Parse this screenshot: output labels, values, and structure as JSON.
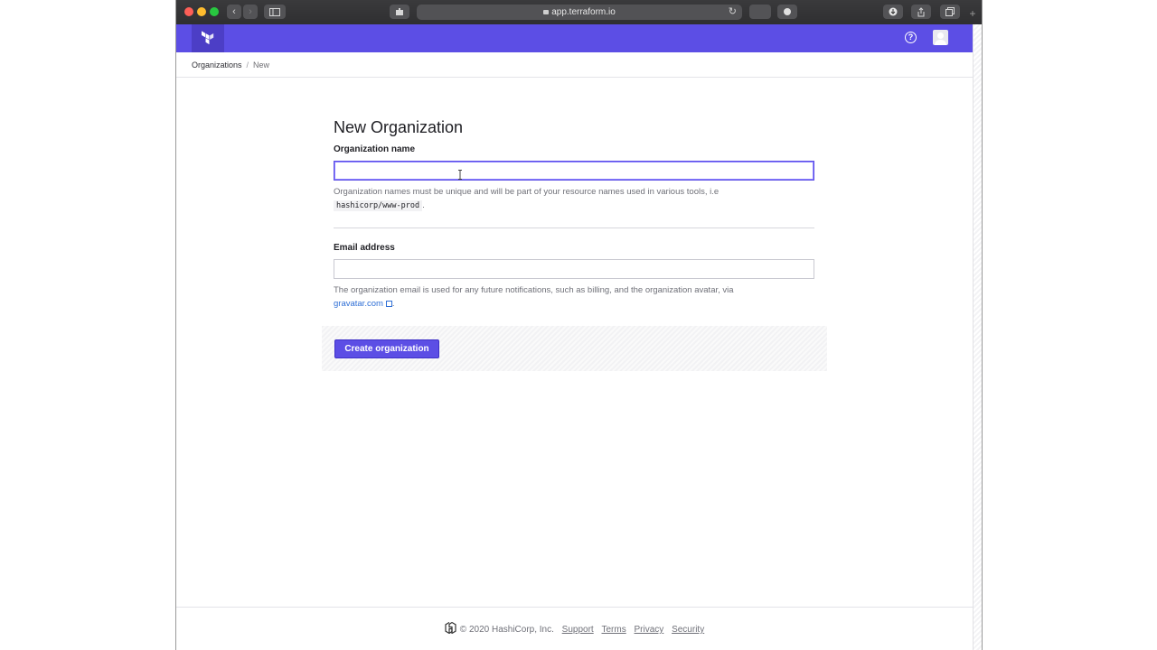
{
  "browser": {
    "url": "app.terraform.io",
    "reload_glyph": "↻",
    "back_glyph": "‹",
    "forward_glyph": "›",
    "new_tab_glyph": "+"
  },
  "header": {
    "help_glyph": "?"
  },
  "breadcrumb": {
    "items": [
      "Organizations",
      "New"
    ],
    "separator": "/"
  },
  "form": {
    "title": "New Organization",
    "org_name_label": "Organization name",
    "org_name_value": "",
    "org_name_help_prefix": "Organization names must be unique and will be part of your resource names used in various tools, i.e",
    "org_name_help_example": "hashicorp/www-prod",
    "org_name_help_suffix": ".",
    "email_label": "Email address",
    "email_value": "",
    "email_help_prefix": "The organization email is used for any future notifications, such as billing, and the organization avatar, via",
    "email_help_link": "gravatar.com",
    "email_help_suffix": ".",
    "submit_label": "Create organization"
  },
  "footer": {
    "copyright": "© 2020 HashiCorp, Inc.",
    "links": [
      "Support",
      "Terms",
      "Privacy",
      "Security"
    ]
  },
  "colors": {
    "brand": "#5c4ee5",
    "link": "#2f6fd6"
  }
}
